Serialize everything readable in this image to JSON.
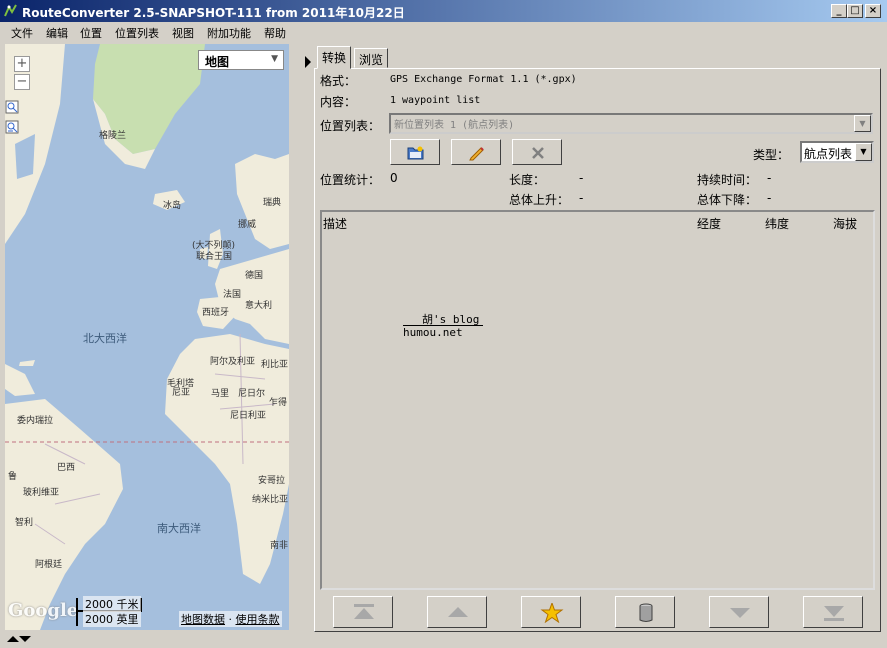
{
  "window": {
    "title": "RouteConverter 2.5-SNAPSHOT-111 from 2011年10月22日",
    "controls": [
      "_",
      "□",
      "×"
    ]
  },
  "menu": [
    "文件",
    "编辑",
    "位置",
    "位置列表",
    "视图",
    "附加功能",
    "帮助"
  ],
  "map": {
    "type_select": "地图",
    "zoom_in": "+",
    "zoom_out": "−",
    "labels": {
      "greenland": "格陵兰",
      "iceland": "冰岛",
      "norway": "挪威",
      "sweden": "瑞典",
      "uk_1": "(大不列颠)",
      "uk_2": "联合王国",
      "germany": "德国",
      "france": "法国",
      "italy": "意大利",
      "spain": "西班牙",
      "north_atlantic": "北大西洋",
      "algeria": "阿尔及利亚",
      "libya": "利比亚",
      "mauritania_1": "毛利塔",
      "mauritania_2": "尼亚",
      "mali": "马里",
      "niger": "尼日尔",
      "chad": "乍得",
      "nigeria": "尼日利亚",
      "venezuela": "委内瑞拉",
      "brazil": "巴西",
      "peru": "鲁",
      "bolivia": "玻利维亚",
      "angola": "安哥拉",
      "botswana": "纳米比亚",
      "chile": "智利",
      "south_atlantic": "南大西洋",
      "south_africa": "南非",
      "argentina": "阿根廷"
    },
    "google": "Google",
    "scale_km": "2000 千米",
    "scale_mi": "2000 英里",
    "map_data": "地图数据",
    "separator": "·",
    "terms": "使用条款"
  },
  "tabs": [
    "转换",
    "浏览"
  ],
  "convert": {
    "format_label": "格式：",
    "format_value": "GPS Exchange Format 1.1 (*.gpx)",
    "content_label": "内容：",
    "content_value": "1 waypoint list",
    "list_label": "位置列表：",
    "list_value": "新位置列表 1 (航点列表)",
    "type_label": "类型：",
    "type_value": "航点列表",
    "stats_label": "位置统计：",
    "stats_value": "0",
    "length_label": "长度：",
    "length_value": "-",
    "duration_label": "持续时间：",
    "duration_value": "-",
    "ascent_label": "总体上升：",
    "ascent_value": "-",
    "descent_label": "总体下降：",
    "descent_value": "-"
  },
  "table": {
    "columns": [
      "描述",
      "经度",
      "纬度",
      "海拔"
    ],
    "rows": []
  },
  "watermark": {
    "blog": "胡's blog",
    "url": "humou.net"
  },
  "colors": {
    "titlebar_start": "#0a246a",
    "titlebar_end": "#a6caf0",
    "window_bg": "#d4d0c8",
    "ocean": "#a5bfdd",
    "land": "#f0ecdc",
    "ice": "#c8dfb0"
  }
}
